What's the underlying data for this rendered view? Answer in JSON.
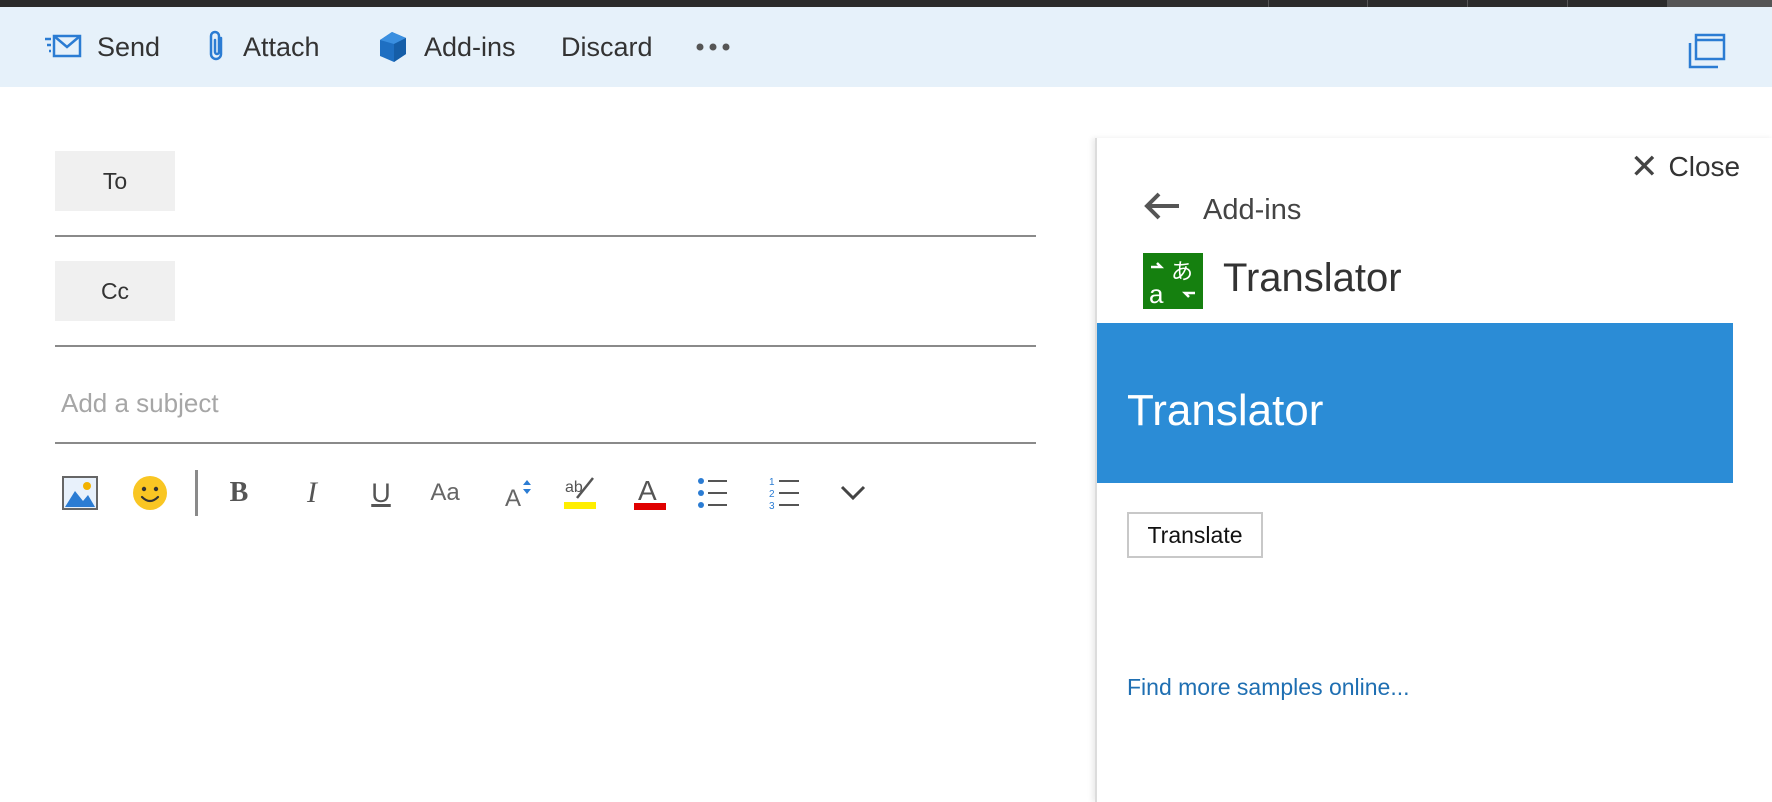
{
  "toolbar": {
    "send_label": "Send",
    "attach_label": "Attach",
    "addins_label": "Add-ins",
    "discard_label": "Discard",
    "more_icon": "more-icon",
    "popout_icon": "popout-icon"
  },
  "compose": {
    "to_label": "To",
    "cc_label": "Cc",
    "subject_placeholder": "Add a subject",
    "subject_value": ""
  },
  "format_toolbar": {
    "items": [
      "insert-picture-icon",
      "emoji-icon",
      "bold-icon",
      "italic-icon",
      "underline-icon",
      "font-size-icon",
      "grow-text-icon",
      "highlight-icon",
      "font-color-icon",
      "bullets-icon",
      "numbering-icon",
      "more-formatting-icon"
    ],
    "bold_glyph": "B",
    "italic_glyph": "I",
    "underline_glyph": "U",
    "font_size_glyph": "Aa",
    "highlight_color": "#ffee00",
    "font_color": "#e00000"
  },
  "addin_pane": {
    "close_label": "Close",
    "back_label": "Add-ins",
    "app_name": "Translator",
    "banner_title": "Translator",
    "translate_button": "Translate",
    "samples_link": "Find more samples online...",
    "accent_color": "#2b8cd6",
    "app_icon_color": "#15800f"
  }
}
